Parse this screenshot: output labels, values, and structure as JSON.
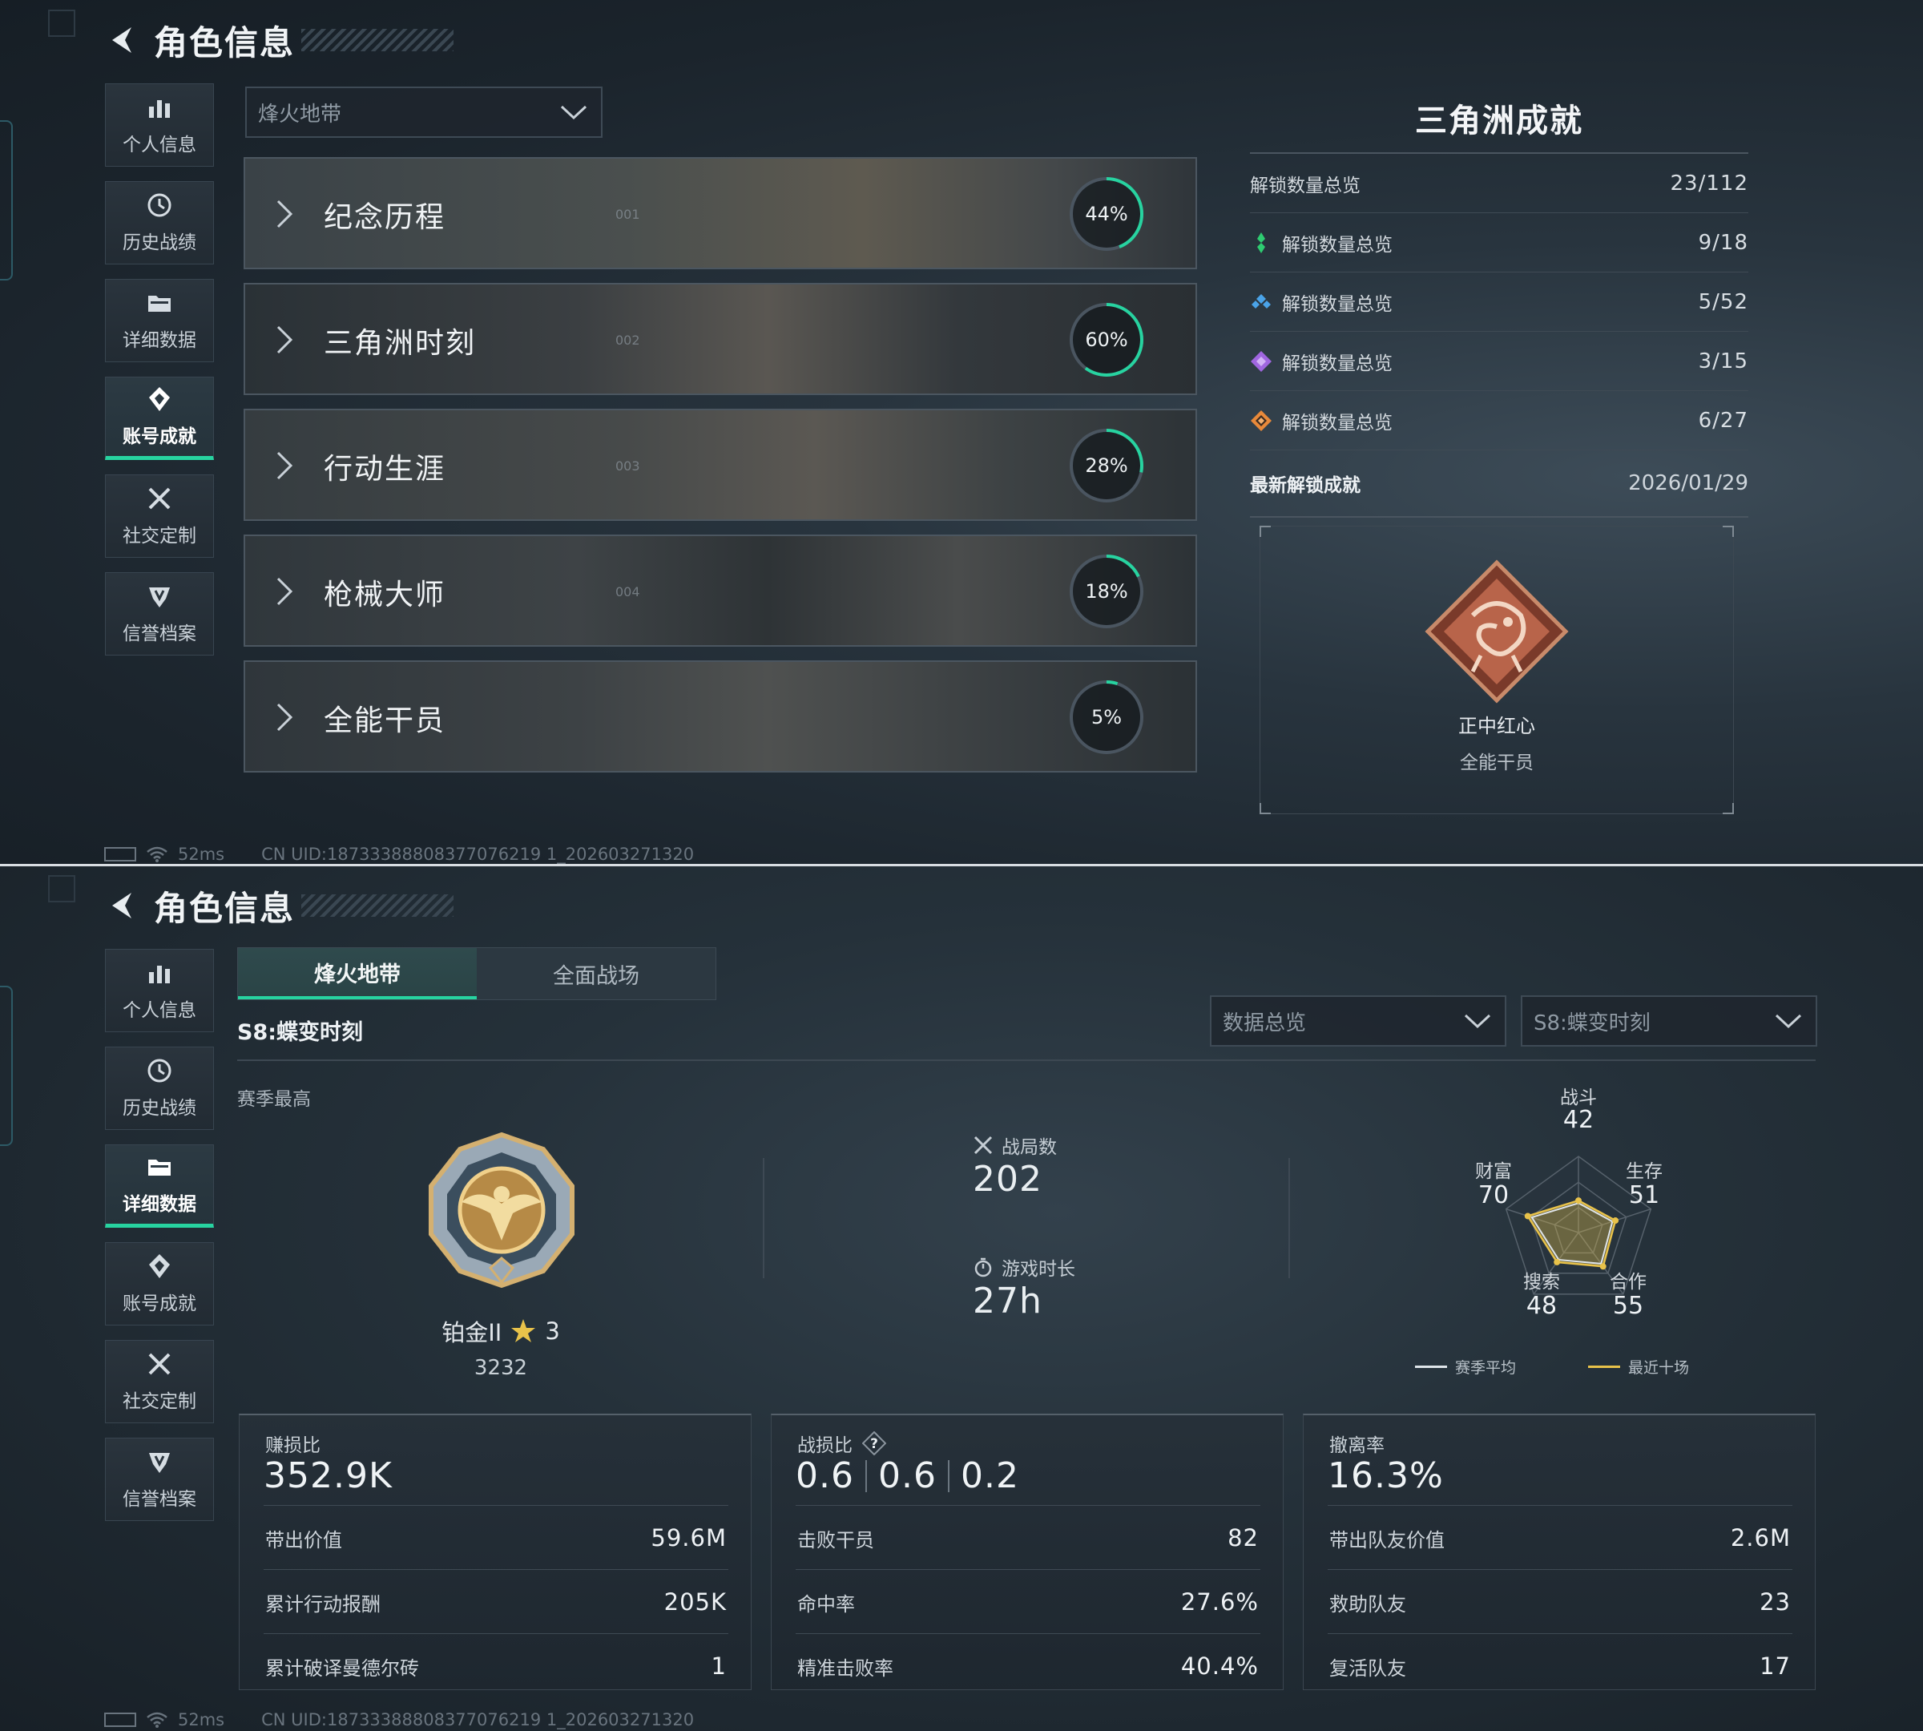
{
  "screen1": {
    "header": {
      "title": "角色信息"
    },
    "sidebar": [
      {
        "label": "个人信息",
        "icon": "bar-chart-icon"
      },
      {
        "label": "历史战绩",
        "icon": "clock-icon"
      },
      {
        "label": "详细数据",
        "icon": "folder-icon"
      },
      {
        "label": "账号成就",
        "icon": "medal-icon",
        "active": true
      },
      {
        "label": "社交定制",
        "icon": "wrench-icon"
      },
      {
        "label": "信誉档案",
        "icon": "shield-icon"
      }
    ],
    "mode_dropdown": {
      "value": "烽火地带"
    },
    "categories": [
      {
        "name": "纪念历程",
        "index": "001",
        "progress": "44%",
        "fraction": 0.44
      },
      {
        "name": "三角洲时刻",
        "index": "002",
        "progress": "60%",
        "fraction": 0.6
      },
      {
        "name": "行动生涯",
        "index": "003",
        "progress": "28%",
        "fraction": 0.28
      },
      {
        "name": "枪械大师",
        "index": "004",
        "progress": "18%",
        "fraction": 0.18
      },
      {
        "name": "全能干员",
        "index": "",
        "progress": "5%",
        "fraction": 0.05
      }
    ],
    "achievements": {
      "title": "三角洲成就",
      "total": {
        "label": "解锁数量总览",
        "value": "23/112"
      },
      "tiers": [
        {
          "label": "解锁数量总览",
          "value": "9/18",
          "color": "#2ecc71"
        },
        {
          "label": "解锁数量总览",
          "value": "5/52",
          "color": "#4aa3e8"
        },
        {
          "label": "解锁数量总览",
          "value": "3/15",
          "color": "#a066e0"
        },
        {
          "label": "解锁数量总览",
          "value": "6/27",
          "color": "#e8893a"
        }
      ],
      "latest": {
        "label": "最新解锁成就",
        "date": "2026/01/29"
      },
      "badge": {
        "name": "正中红心",
        "category": "全能干员",
        "icon": "dragon-badge-icon"
      }
    },
    "footer": {
      "ping": "52ms",
      "uid": "CN UID:18733388808377076219 1_202603271320"
    }
  },
  "screen2": {
    "header": {
      "title": "角色信息"
    },
    "sidebar": [
      {
        "label": "个人信息",
        "icon": "bar-chart-icon"
      },
      {
        "label": "历史战绩",
        "icon": "clock-icon"
      },
      {
        "label": "详细数据",
        "icon": "folder-icon",
        "active": true
      },
      {
        "label": "账号成就",
        "icon": "medal-icon"
      },
      {
        "label": "社交定制",
        "icon": "wrench-icon"
      },
      {
        "label": "信誉档案",
        "icon": "shield-icon"
      }
    ],
    "tabs": [
      "烽火地带",
      "全面战场"
    ],
    "active_tab": 0,
    "season_title": "S8:蝶变时刻",
    "dropdowns": {
      "data": "数据总览",
      "season": "S8:蝶变时刻"
    },
    "season_best_label": "赛季最高",
    "rank": {
      "name": "铂金II",
      "stars": "3",
      "points": "3232"
    },
    "matches": {
      "label": "战局数",
      "value": "202"
    },
    "playtime": {
      "label": "游戏时长",
      "value": "27h"
    },
    "radar": {
      "axes": [
        {
          "label": "战斗",
          "value": "42"
        },
        {
          "label": "生存",
          "value": "51"
        },
        {
          "label": "合作",
          "value": "55"
        },
        {
          "label": "搜索",
          "value": "48"
        },
        {
          "label": "财富",
          "value": "70"
        }
      ],
      "legend": [
        {
          "label": "赛季平均",
          "color": "#dfe5ea"
        },
        {
          "label": "最近十场",
          "color": "#e8c24a"
        }
      ]
    },
    "cards": [
      {
        "title": "赚损比",
        "values": [
          "352.9K"
        ],
        "rows": [
          {
            "label": "带出价值",
            "value": "59.6M"
          },
          {
            "label": "累计行动报酬",
            "value": "205K"
          },
          {
            "label": "累计破译曼德尔砖",
            "value": "1"
          }
        ]
      },
      {
        "title": "战损比",
        "values": [
          "0.6",
          "0.6",
          "0.2"
        ],
        "rows": [
          {
            "label": "击败干员",
            "value": "82"
          },
          {
            "label": "命中率",
            "value": "27.6%"
          },
          {
            "label": "精准击败率",
            "value": "40.4%"
          }
        ]
      },
      {
        "title": "撤离率",
        "values": [
          "16.3%"
        ],
        "rows": [
          {
            "label": "带出队友价值",
            "value": "2.6M"
          },
          {
            "label": "救助队友",
            "value": "23"
          },
          {
            "label": "复活队友",
            "value": "17"
          }
        ]
      }
    ],
    "footer": {
      "ping": "52ms",
      "uid": "CN UID:18733388808377076219 1_202603271320"
    }
  },
  "colors": {
    "accent": "#27d3a0",
    "gold": "#e8c24a"
  }
}
